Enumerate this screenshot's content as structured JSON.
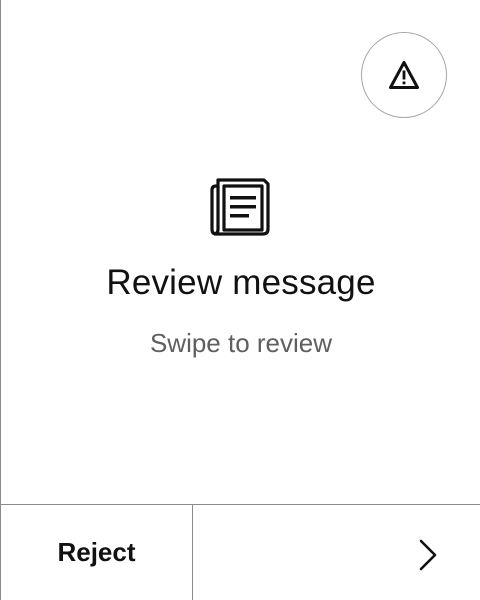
{
  "review": {
    "title": "Review message",
    "subtitle": "Swipe to review"
  },
  "footer": {
    "reject_label": "Reject"
  },
  "icons": {
    "warning": "warning-triangle-icon",
    "message": "message-document-icon",
    "next": "chevron-right-icon"
  },
  "colors": {
    "text": "#111111",
    "subtitle": "#5f5f5f",
    "divider": "#8c8c8c"
  }
}
